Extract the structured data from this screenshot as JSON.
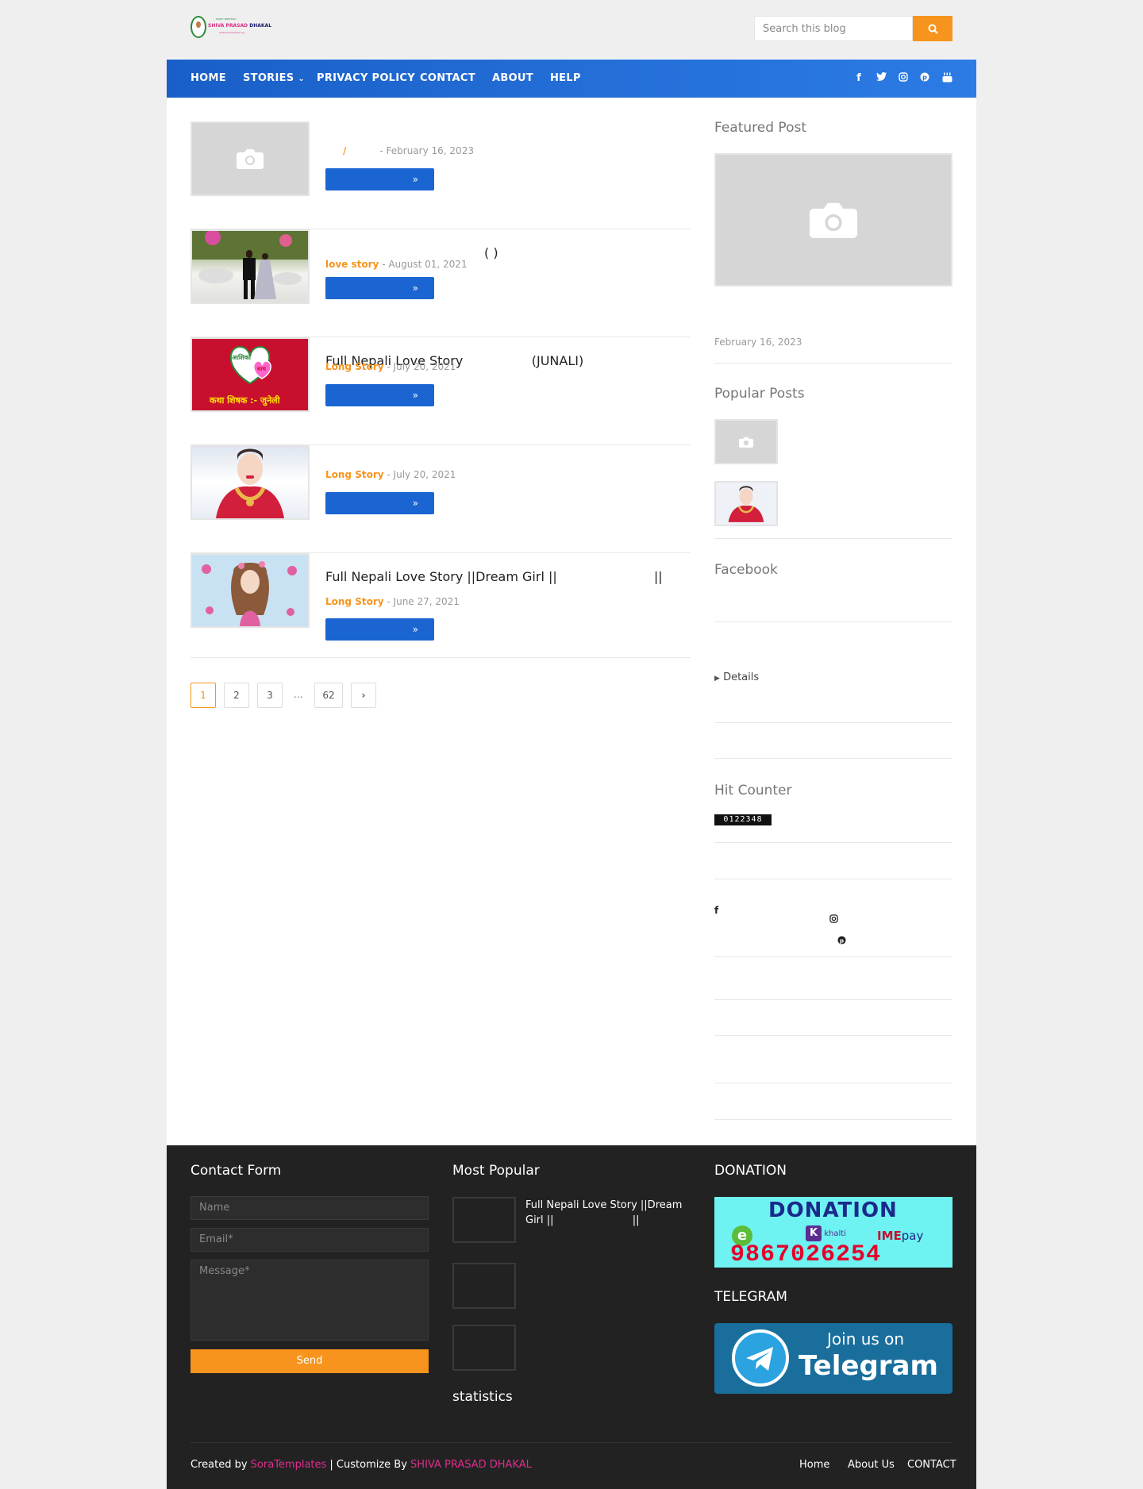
{
  "header": {
    "logo": {
      "small": "HAPPY BIRTHDAY",
      "name_part1": "SHIVA PRASAD",
      "name_part2": "DHAKAL",
      "url": "www.shivaprasad.org"
    },
    "search_placeholder": "Search this blog"
  },
  "nav": {
    "items": [
      "HOME",
      "STORIES",
      "PRIVACY POLICY",
      "CONTACT",
      "ABOUT",
      "HELP"
    ],
    "social": [
      "facebook-icon",
      "twitter-icon",
      "instagram-icon",
      "pinterest-icon",
      "youtube-icon"
    ]
  },
  "posts": [
    {
      "title": "",
      "label": "/",
      "date": "- February 16, 2023",
      "read_more": "»"
    },
    {
      "title": "(          )",
      "label": "love story",
      "date": "- August 01, 2021",
      "read_more": "»"
    },
    {
      "title": "Full Nepali Love Story                 (JUNALI)",
      "label": "Long Story",
      "date": "- July 20, 2021",
      "read_more": "»",
      "thumb_text1": "आशिका",
      "thumb_text2": "साथ",
      "thumb_text3": "कथा शिषक :- जुनेली"
    },
    {
      "title": "",
      "label": "Long Story",
      "date": "- July 20, 2021",
      "read_more": "»"
    },
    {
      "title": "Full Nepali Love Story ||Dream Girl ||                        ||",
      "label": "Long Story",
      "date": "- June 27, 2021",
      "read_more": "»"
    }
  ],
  "pagination": {
    "pages": [
      "1",
      "2",
      "3"
    ],
    "ellipsis": "...",
    "last": "62"
  },
  "sidebar": {
    "featured_title": "Featured Post",
    "featured_date": "February 16, 2023",
    "popular_title": "Popular Posts",
    "facebook_title": "Facebook",
    "details": "Details",
    "hit_counter_title": "Hit Counter",
    "hit_counter_value": "0122348"
  },
  "footer": {
    "contact_title": "Contact Form",
    "name_placeholder": "Name",
    "email_placeholder": "Email*",
    "message_placeholder": "Message*",
    "send": "Send",
    "most_popular_title": "Most Popular",
    "most_popular_item": "Full Nepali Love Story ||Dream Girl ||                        ||",
    "statistics_title": "statistics",
    "donation_title": "DONATION",
    "donation_banner": {
      "title": "DONATION",
      "khalti": "khalti",
      "ime": "IME",
      "pay": "pay",
      "phone": "9867026254"
    },
    "telegram_title": "TELEGRAM",
    "telegram_banner": {
      "line1": "Join us on",
      "line2": "Telegram"
    },
    "created_by": "Created by",
    "sora": "SoraTemplates",
    "customize": " | Customize By ",
    "author": "SHIVA PRASAD DHAKAL",
    "links": [
      "Home",
      "About Us",
      "CONTACT"
    ]
  }
}
